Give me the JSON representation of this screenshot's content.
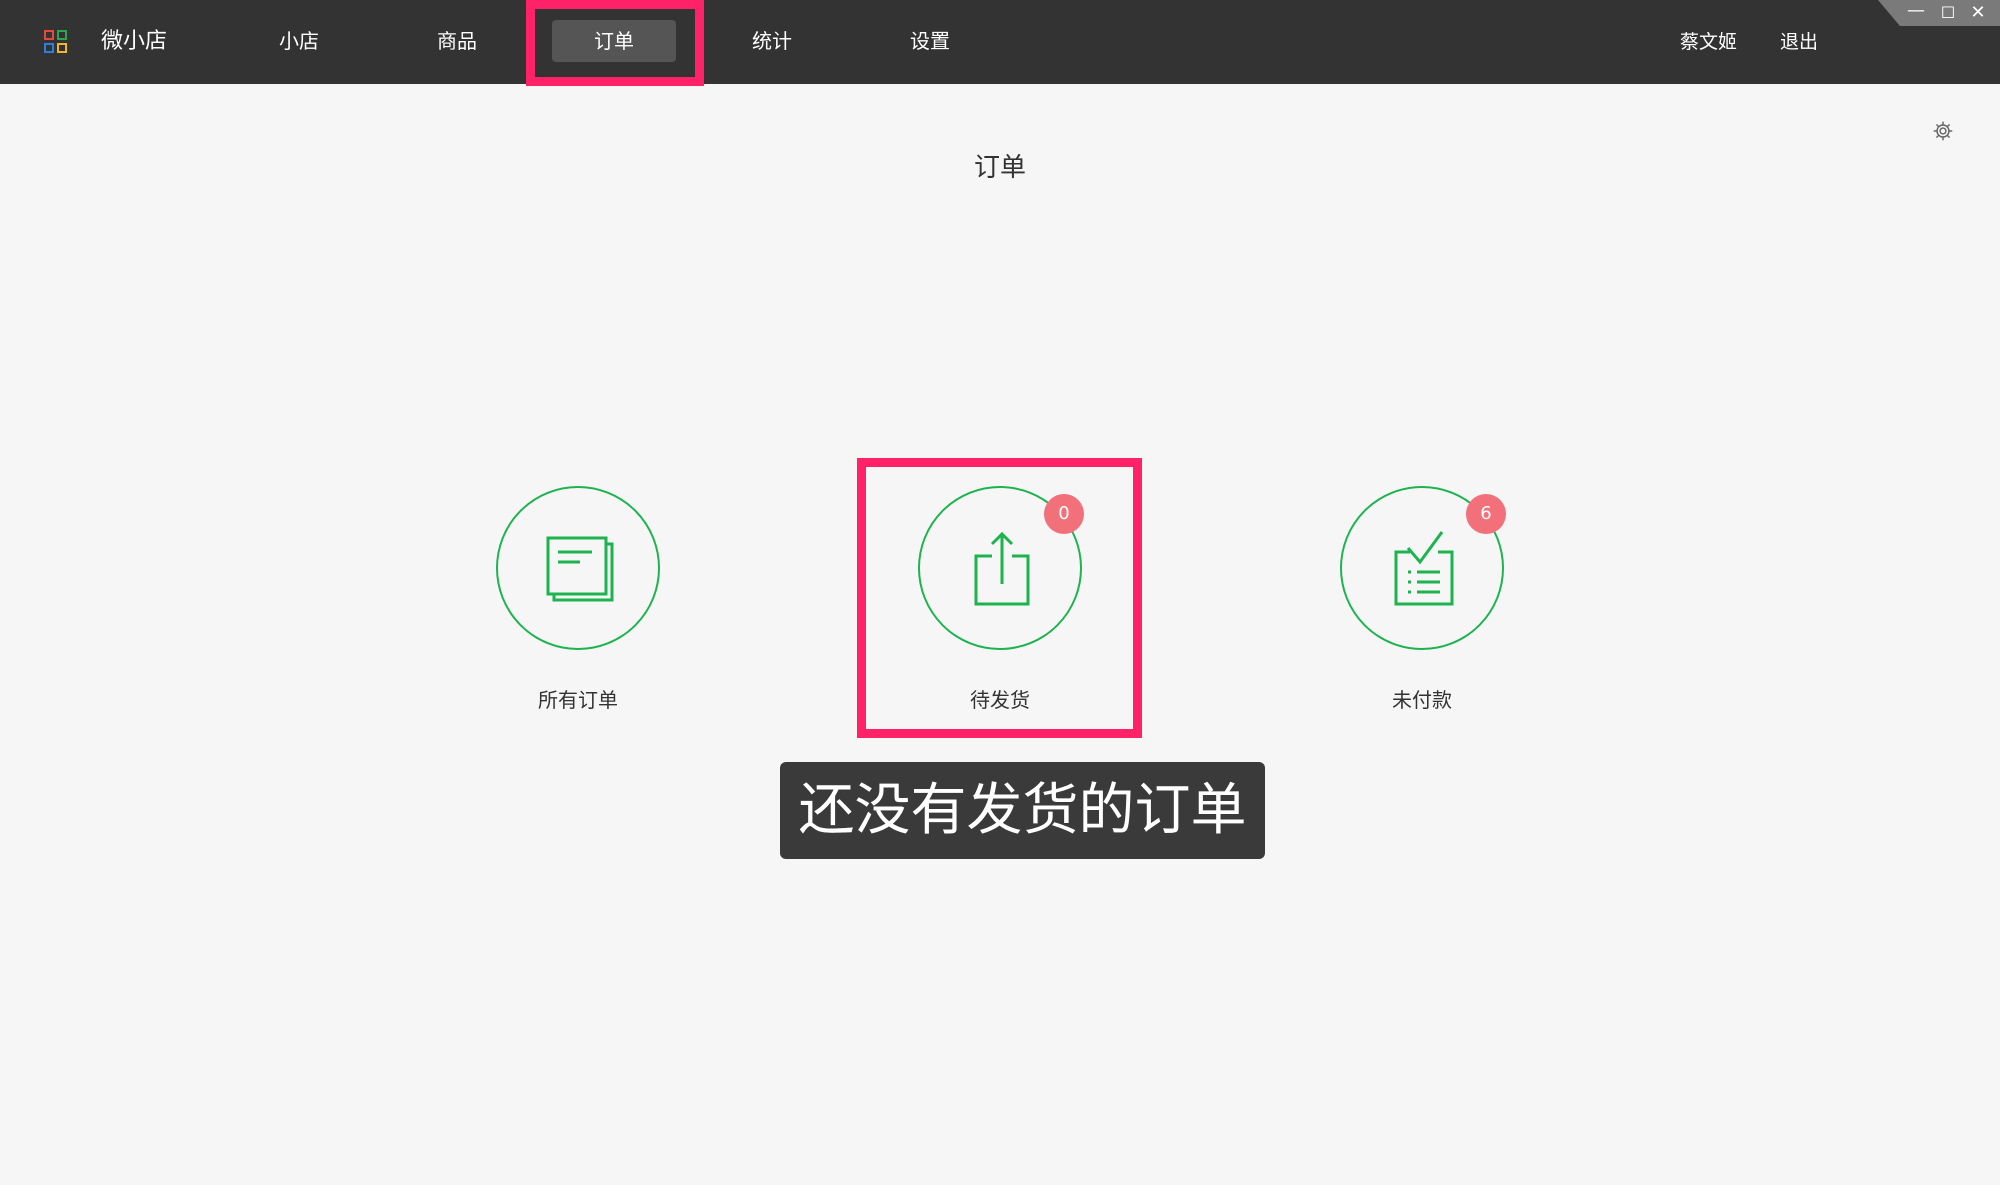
{
  "app": {
    "name": "微小店"
  },
  "nav": {
    "items": [
      {
        "label": "小店"
      },
      {
        "label": "商品"
      },
      {
        "label": "订单",
        "active": true
      },
      {
        "label": "统计"
      },
      {
        "label": "设置"
      }
    ]
  },
  "user": {
    "name": "蔡文姬",
    "logout_label": "退出"
  },
  "window_controls": {
    "minimize": "—",
    "maximize": "☐",
    "close": "✕"
  },
  "main": {
    "title": "订单",
    "cards": [
      {
        "label": "所有订单",
        "icon": "documents-icon",
        "badge": null
      },
      {
        "label": "待发货",
        "icon": "share-upload-icon",
        "badge": "0"
      },
      {
        "label": "未付款",
        "icon": "checklist-icon",
        "badge": "6"
      }
    ]
  },
  "caption": {
    "text": "还没有发货的订单"
  },
  "colors": {
    "accent_green": "#1db34f",
    "badge_red": "#f2707a",
    "highlight": "#ff2268",
    "topbar": "#333333"
  }
}
